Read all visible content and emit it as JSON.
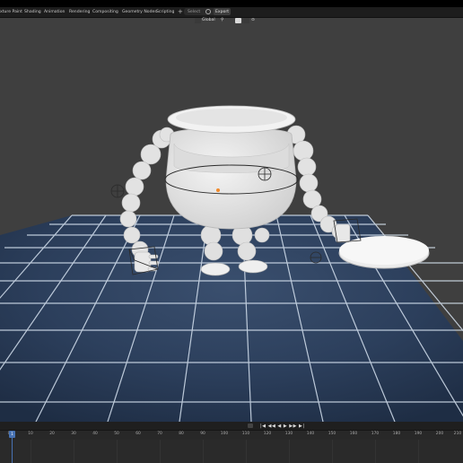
{
  "workspace_tabs": [
    "xture Paint",
    "Shading",
    "Animation",
    "Rendering",
    "Compositing",
    "Geometry Nodes",
    "Scripting"
  ],
  "add_workspace": "+",
  "scene": {
    "left_label": "Select",
    "right_label": "Export"
  },
  "viewport_header": {
    "transform_orientation": "Global",
    "snap_symbol": "⚲",
    "proportional_symbol": "⊙"
  },
  "timeline": {
    "ticks": [
      "0",
      "10",
      "20",
      "30",
      "40",
      "50",
      "60",
      "70",
      "80",
      "90",
      "100",
      "110",
      "120",
      "130",
      "140",
      "150",
      "160",
      "170",
      "180",
      "190",
      "200",
      "210"
    ],
    "current_frame": "1",
    "playback_glyphs": "|◀ ◀◀ ◀ ▶ ▶▶ ▶|"
  },
  "colors": {
    "accent": "#4772b3",
    "viewport_bg": "#3f3f3f",
    "grid_line": "#d6e2f0",
    "model": "#e6e6e6"
  }
}
